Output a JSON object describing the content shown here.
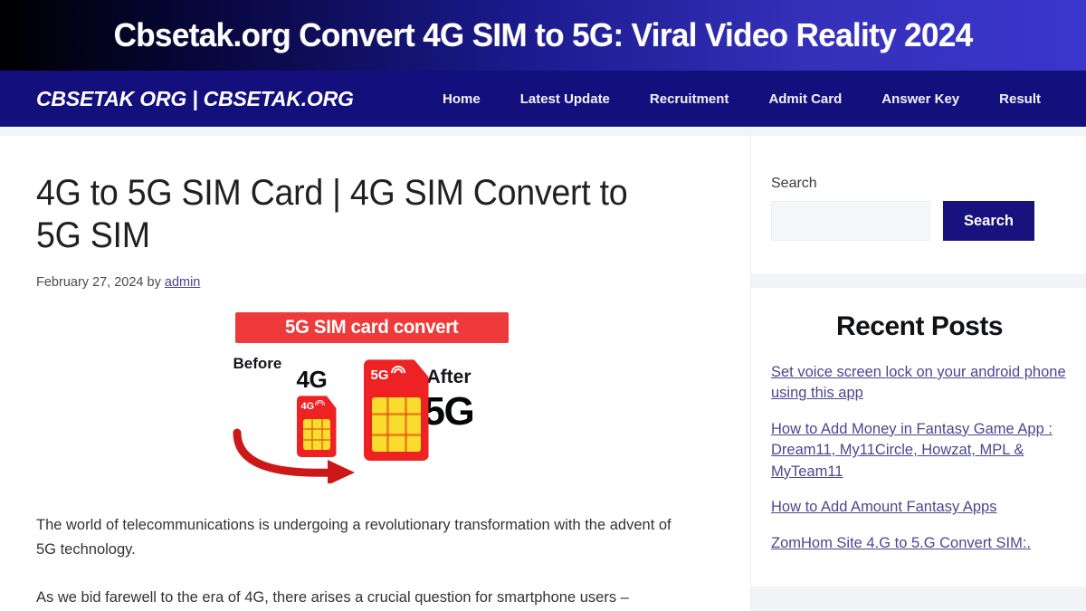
{
  "banner": {
    "title": "Cbsetak.org Convert 4G SIM to 5G: Viral Video Reality 2024",
    "gradient_from": "#000000",
    "gradient_to": "#3b36cc"
  },
  "navbar": {
    "brand": "CBSETAK ORG | CBSETAK.ORG",
    "bg_color": "#13107e",
    "links": [
      {
        "label": "Home"
      },
      {
        "label": "Latest Update"
      },
      {
        "label": "Recruitment"
      },
      {
        "label": "Admit Card"
      },
      {
        "label": "Answer Key"
      },
      {
        "label": "Result"
      }
    ]
  },
  "article": {
    "title": "4G to 5G SIM Card | 4G SIM Convert to 5G SIM",
    "date": "February 27, 2024 by ",
    "author": "admin",
    "figure": {
      "banner_text": "5G SIM card convert",
      "before_label": "Before",
      "before_value": "4G",
      "after_label": "After",
      "after_value": "5G",
      "small_sim_label": "4G",
      "big_sim_label": "5G",
      "banner_color": "#ee3a3a",
      "sim_color": "#ee2222",
      "chip_color": "#f8dc2e"
    },
    "paragraphs": [
      "The world of telecommunications is undergoing a revolutionary transformation with the advent of 5G technology.",
      "As we bid farewell to the era of 4G, there arises a crucial question for smartphone users –"
    ]
  },
  "sidebar": {
    "search": {
      "label": "Search",
      "value": "",
      "placeholder": "",
      "button_label": "Search",
      "button_color": "#17127e"
    },
    "recent_posts": {
      "title": "Recent Posts",
      "link_color": "#4b4790",
      "items": [
        {
          "label": "Set voice screen lock on your android phone using this app"
        },
        {
          "label": "How to Add Money in Fantasy Game App : Dream11, My11Circle, Howzat, MPL & MyTeam11"
        },
        {
          "label": "How to Add Amount Fantasy Apps"
        },
        {
          "label": "ZomHom Site 4.G to 5.G Convert SIM:."
        }
      ]
    }
  }
}
